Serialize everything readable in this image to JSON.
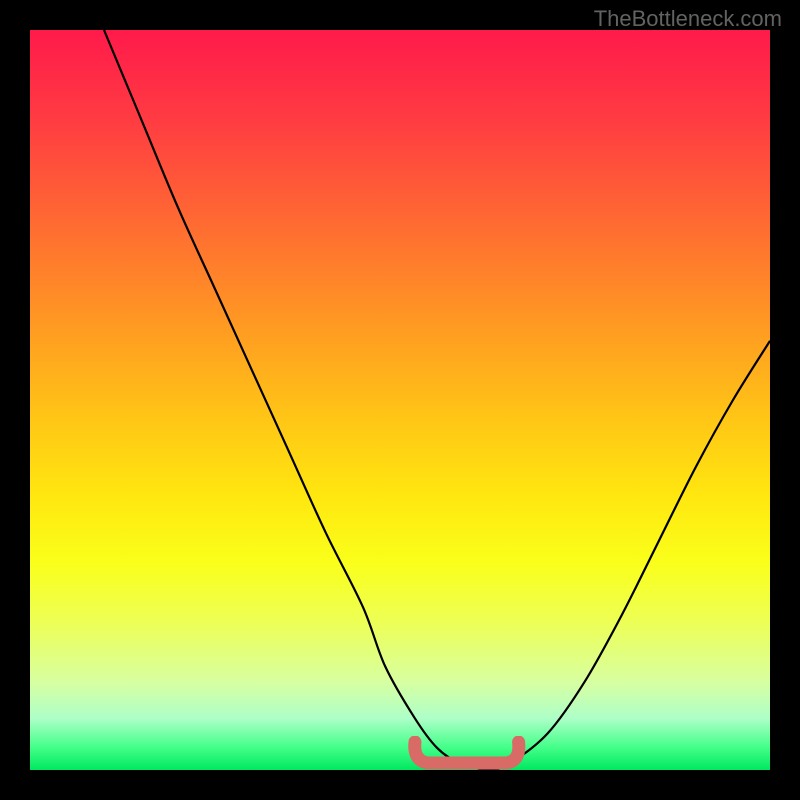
{
  "watermark": "TheBottleneck.com",
  "colors": {
    "background": "#000000",
    "watermark_text": "#626262",
    "curve": "#000000",
    "segment": "#d86b66",
    "gradient_stops": [
      "#ff1a4b",
      "#ff3b42",
      "#ff6a32",
      "#ff9a22",
      "#ffc416",
      "#ffe70f",
      "#faff1a",
      "#edff55",
      "#d8ffa0",
      "#aeffc8",
      "#42ff88",
      "#00e860"
    ]
  },
  "chart_data": {
    "type": "line",
    "title": "",
    "xlabel": "",
    "ylabel": "",
    "xlim": [
      0,
      100
    ],
    "ylim": [
      0,
      100
    ],
    "series": [
      {
        "name": "curve",
        "x": [
          10,
          15,
          20,
          25,
          30,
          35,
          40,
          45,
          48,
          52,
          55,
          58,
          62,
          65,
          70,
          75,
          80,
          85,
          90,
          95,
          100
        ],
        "values": [
          100,
          88,
          76,
          65,
          54,
          43,
          32,
          22,
          14,
          7,
          3,
          1,
          0,
          1,
          5,
          12,
          21,
          31,
          41,
          50,
          58
        ]
      }
    ],
    "highlight_segment": {
      "x_start": 52,
      "x_end": 66,
      "y": 0
    }
  }
}
